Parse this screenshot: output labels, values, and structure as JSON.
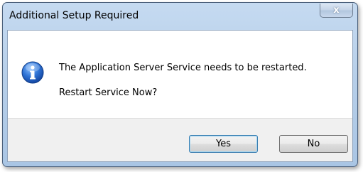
{
  "dialog": {
    "title": "Additional Setup Required",
    "close_label": "x",
    "icon": "info-icon",
    "message": "The Application Server Service needs to be restarted.",
    "prompt": "Restart Service Now?",
    "buttons": {
      "yes_label": "Yes",
      "no_label": "No"
    }
  },
  "colors": {
    "titlebar": "#b7cfe9",
    "footer": "#f0f0f0",
    "info_icon": "#1f5fc4"
  }
}
